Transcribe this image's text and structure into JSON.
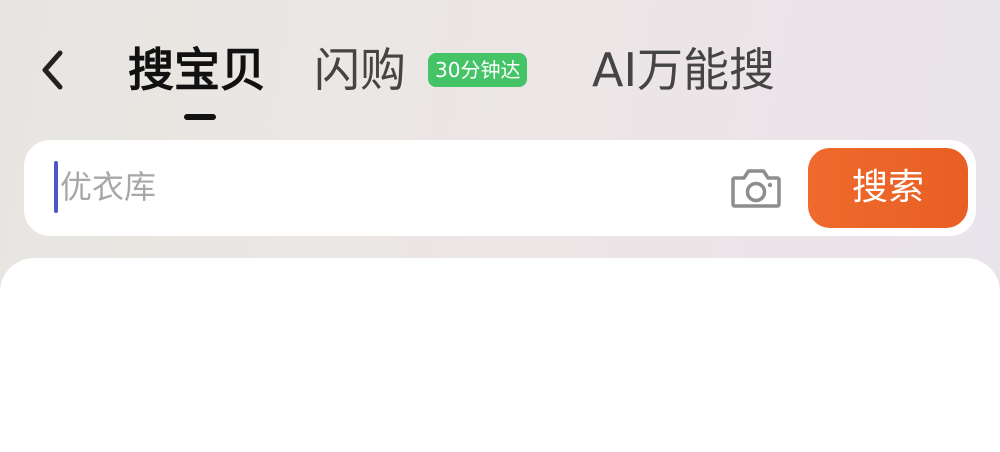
{
  "header": {
    "tabs": [
      {
        "label": "搜宝贝",
        "active": true
      },
      {
        "label": "闪购",
        "badge": "30分钟达"
      },
      {
        "label": "AI万能搜"
      }
    ]
  },
  "search": {
    "placeholder": "优衣库",
    "button_label": "搜索"
  },
  "icons": {
    "back": "chevron-left-icon",
    "camera": "camera-icon"
  },
  "colors": {
    "accent": "#E8632A",
    "badge": "#45C467",
    "caret": "#4E56C8"
  }
}
